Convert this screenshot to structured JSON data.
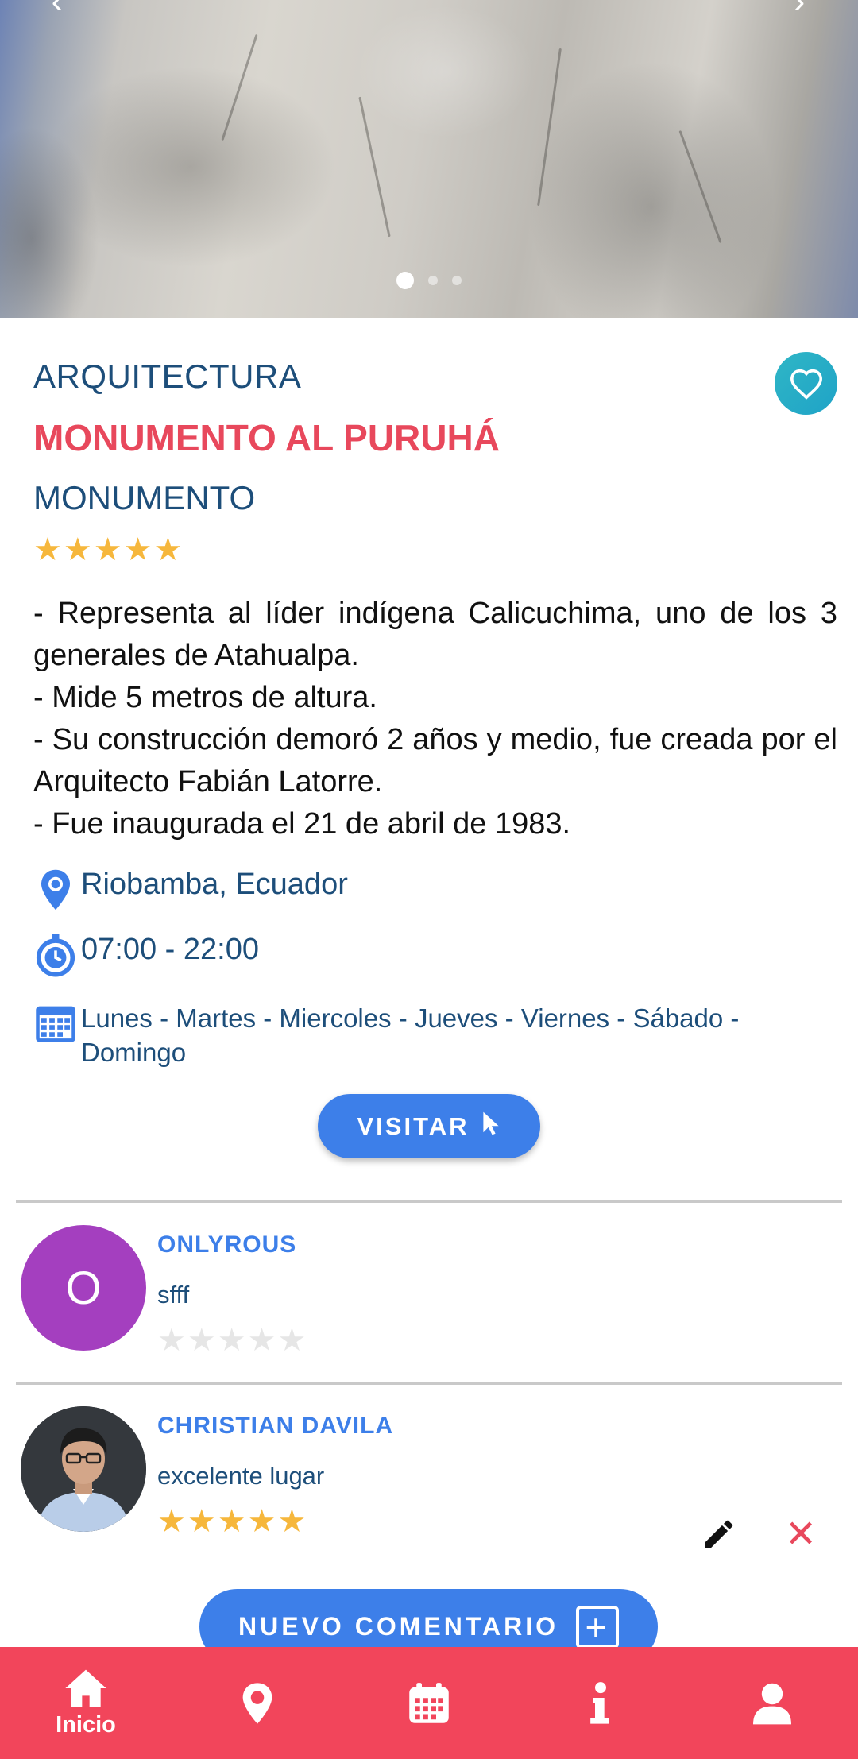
{
  "place": {
    "category": "ARQUITECTURA",
    "name": "MONUMENTO AL PURUHÁ",
    "type": "MONUMENTO",
    "rating": 5,
    "description": [
      "- Representa al líder indígena Calicuchima, uno de los 3 generales de Atahualpa.",
      "- Mide 5 metros de altura.",
      "- Su construcción demoró 2 años y medio, fue creada por el Arquitecto Fabián Latorre.",
      "- Fue inaugurada el 21 de abril de 1983."
    ],
    "location": "Riobamba, Ecuador",
    "hours": "07:00 - 22:00",
    "days": "Lunes - Martes - Miercoles - Jueves - Viernes - Sábado - Domingo"
  },
  "carousel": {
    "slide_count": 3,
    "active_index": 0
  },
  "actions": {
    "visit_label": "VISITAR",
    "new_comment_label": "NUEVO COMENTARIO"
  },
  "comments": [
    {
      "avatar_letter": "O",
      "user": "ONLYROUS",
      "text": "sfff",
      "rating": 0,
      "editable": false
    },
    {
      "avatar_letter": "",
      "user": "CHRISTIAN DAVILA",
      "text": "excelente lugar",
      "rating": 5,
      "editable": true
    }
  ],
  "nav": {
    "items": [
      {
        "label": "Inicio",
        "icon": "home-icon",
        "active": true
      },
      {
        "label": "",
        "icon": "map-pin-icon",
        "active": false
      },
      {
        "label": "",
        "icon": "calendar-icon",
        "active": false
      },
      {
        "label": "",
        "icon": "info-icon",
        "active": false
      },
      {
        "label": "",
        "icon": "user-icon",
        "active": false
      }
    ]
  },
  "colors": {
    "accent_red": "#e8485c",
    "nav_red": "#f2455b",
    "button_blue": "#3d7fe9",
    "text_navy": "#1d4e7a",
    "star_gold": "#f6b73c",
    "avatar_purple": "#a43fbf",
    "fav_teal": "#2fb6c6"
  }
}
